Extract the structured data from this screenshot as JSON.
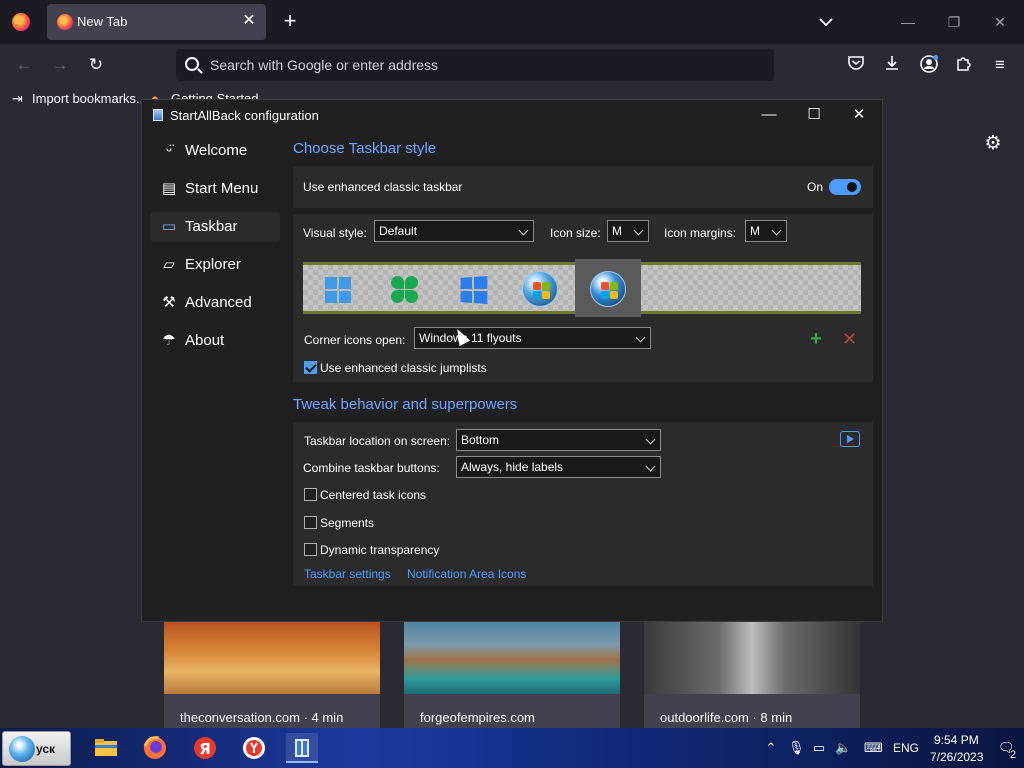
{
  "browser": {
    "tab_title": "New Tab",
    "url_placeholder": "Search with Google or enter address",
    "bookmarks": [
      "Import bookmarks...",
      "Getting Started"
    ],
    "tiles": [
      {
        "caption": "theconversation.com · 4 min"
      },
      {
        "caption": "forgeofempires.com"
      },
      {
        "caption": "outdoorlife.com · 8 min"
      }
    ]
  },
  "dialog": {
    "title": "StartAllBack configuration",
    "sidebar": [
      {
        "label": "Welcome",
        "icon": "smile-icon"
      },
      {
        "label": "Start Menu",
        "icon": "start-menu-icon"
      },
      {
        "label": "Taskbar",
        "icon": "taskbar-icon"
      },
      {
        "label": "Explorer",
        "icon": "folder-icon"
      },
      {
        "label": "Advanced",
        "icon": "wrench-icon"
      },
      {
        "label": "About",
        "icon": "umbrella-icon"
      }
    ],
    "active_item": "Taskbar",
    "section1": {
      "title": "Choose Taskbar style",
      "enhanced_label": "Use enhanced classic taskbar",
      "toggle_state": "On",
      "visual_style_label": "Visual style:",
      "visual_style_value": "Default",
      "icon_size_label": "Icon size:",
      "icon_size_value": "M",
      "icon_margins_label": "Icon margins:",
      "icon_margins_value": "M",
      "corner_label": "Corner icons open:",
      "corner_value": "Windows 11 flyouts",
      "jumplists_label": "Use enhanced classic jumplists",
      "jumplists_checked": true
    },
    "section2": {
      "title": "Tweak behavior and superpowers",
      "location_label": "Taskbar location on screen:",
      "location_value": "Bottom",
      "combine_label": "Combine taskbar buttons:",
      "combine_value": "Always, hide labels",
      "centered_label": "Centered task icons",
      "segments_label": "Segments",
      "dynamic_label": "Dynamic transparency",
      "link_taskbar": "Taskbar settings",
      "link_notification": "Notification Area Icons"
    }
  },
  "taskbar": {
    "start_label": "уск",
    "lang": "ENG",
    "time": "9:54 PM",
    "date": "7/26/2023",
    "notif_count": "2"
  },
  "colors": {
    "accent": "#4c9dff",
    "heading": "#6ba7ff",
    "dialog_bg": "#202020",
    "panel_bg": "#2b2b2b"
  }
}
